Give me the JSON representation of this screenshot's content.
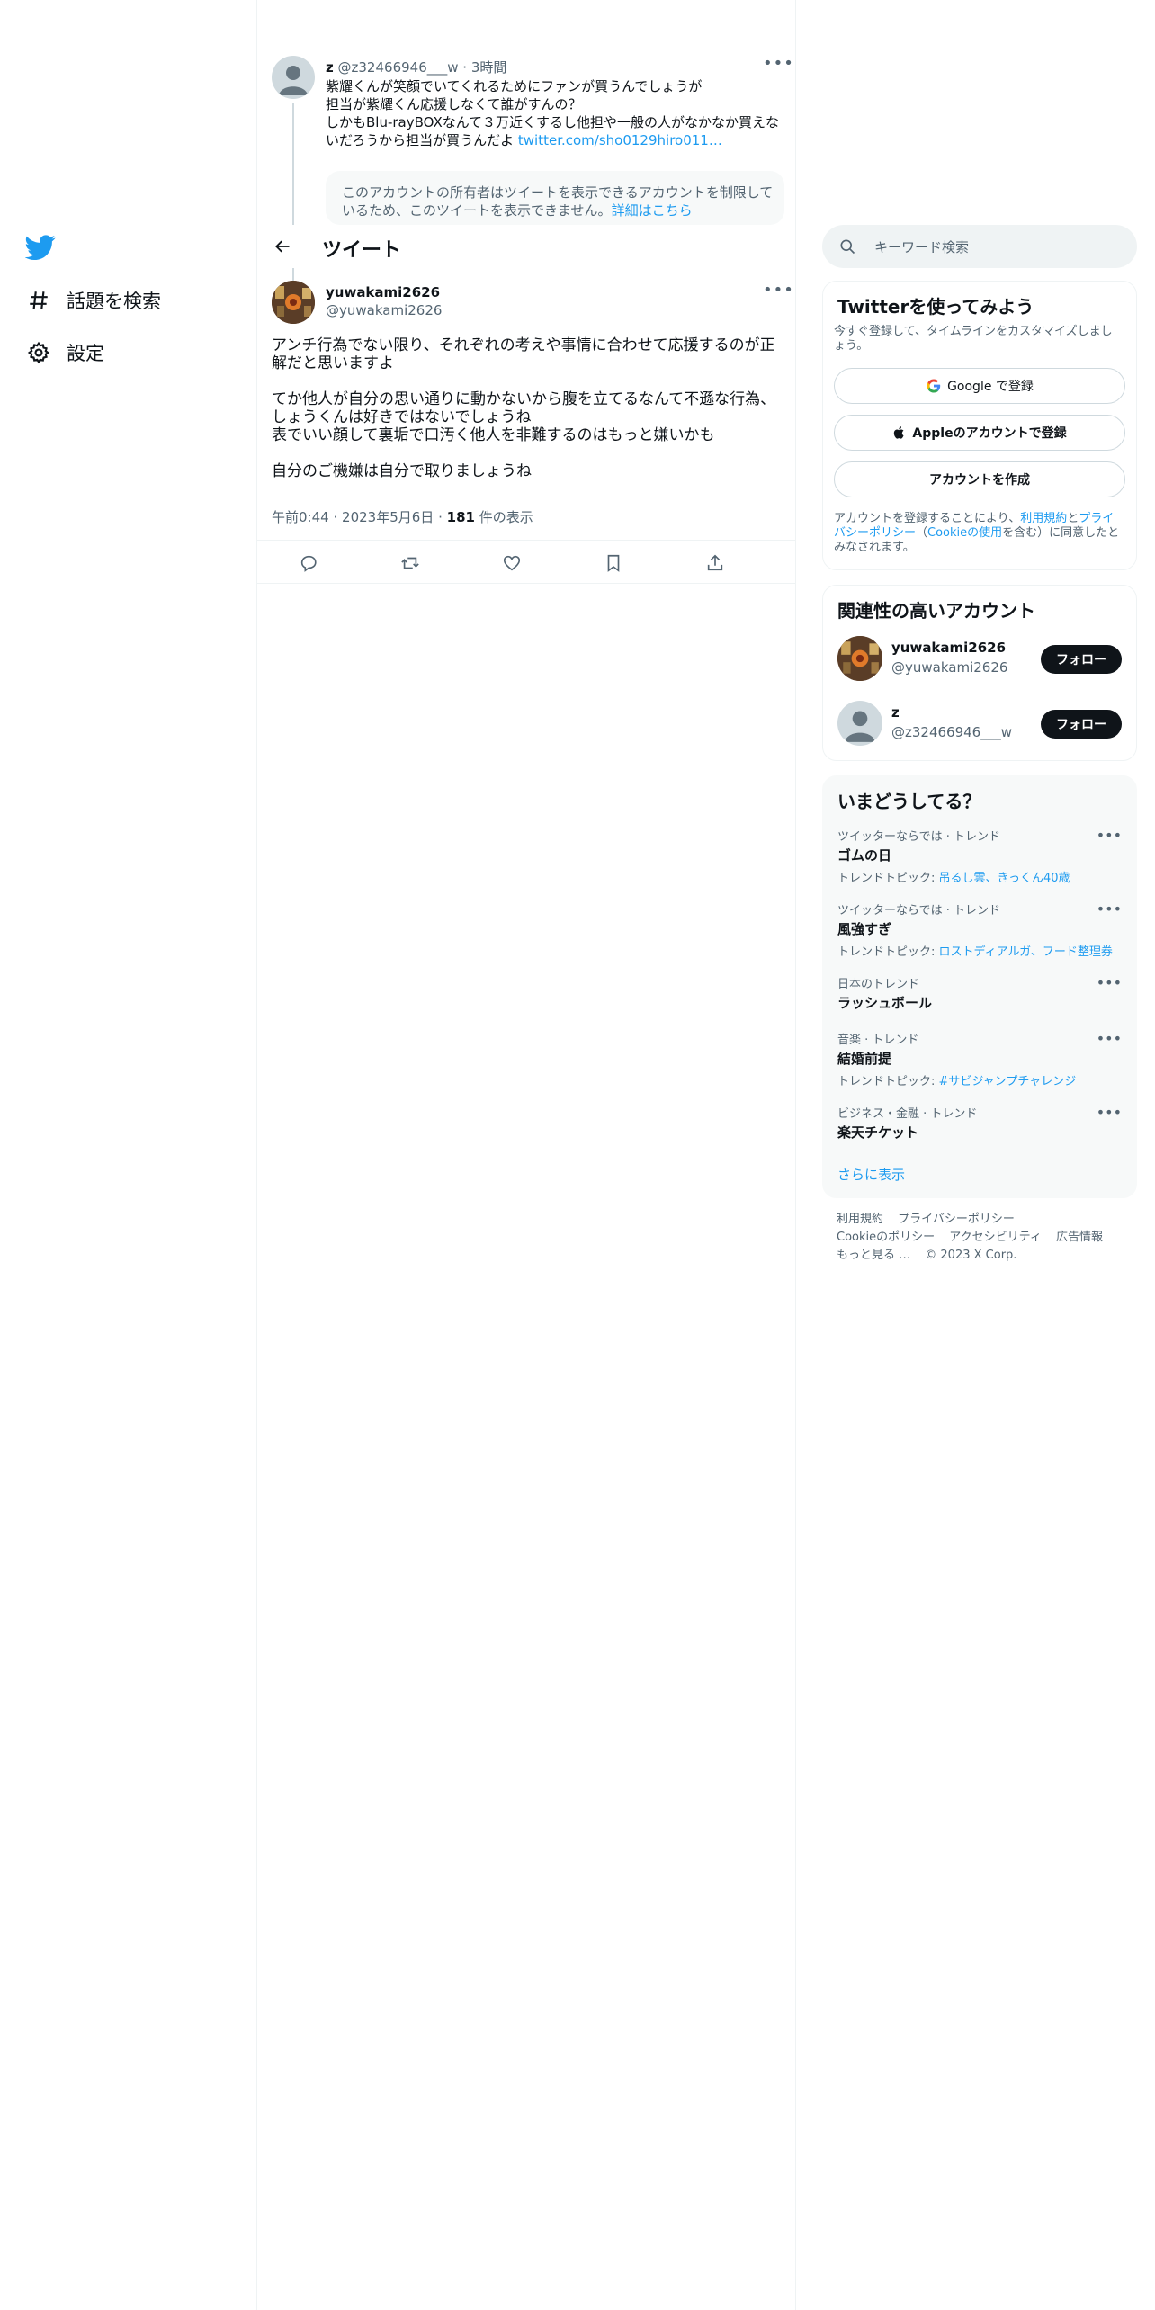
{
  "nav": {
    "explore_label": "話題を検索",
    "settings_label": "設定"
  },
  "header": {
    "title": "ツイート"
  },
  "parent_tweet": {
    "name": "z",
    "handle": "@z32466946___w",
    "separator": "·",
    "time": "3時間",
    "lines": [
      "紫耀くんが笑顔でいてくれるためにファンが買うんでしょうが",
      "担当が紫耀くん応援しなくて誰がすんの？",
      "しかもBlu-rayBOXなんて３万近くするし他担や一般の人がなかなか買えな",
      "いだろうから担当が買うんだよ"
    ],
    "link": "twitter.com/sho0129hiro011…",
    "restricted_text": "このアカウントの所有者はツイートを表示できるアカウントを制限しているため、このツイートを表示できません。",
    "restricted_link": "詳細はこちら"
  },
  "focal_tweet": {
    "name": "yuwakami2626",
    "handle": "@yuwakami2626",
    "paragraphs": [
      [
        "アンチ行為でない限り、それぞれの考えや事情に合わせて応援するのが正",
        "解だと思いますよ"
      ],
      [
        "てか他人が自分の思い通りに動かないから腹を立てるなんて不遜な行為、",
        "しょうくんは好きではないでしょうね",
        "表でいい顔して裏垢で口汚く他人を非難するのはもっと嫌いかも"
      ],
      [
        "自分のご機嫌は自分で取りましょうね"
      ]
    ],
    "time": "午前0:44",
    "date": "2023年5月6日",
    "dot": "·",
    "views_count": "181",
    "views_label": "件の表示"
  },
  "search": {
    "placeholder": "キーワード検索"
  },
  "signup": {
    "title": "Twitterを使ってみよう",
    "subtitle": "今すぐ登録して、タイムラインをカスタマイズしましょう。",
    "google_label": "Google で登録",
    "apple_label": "Appleのアカウントで登録",
    "create_label": "アカウントを作成",
    "legal_prefix": "アカウントを登録することにより、",
    "terms_link": "利用規約",
    "and": "と",
    "privacy_link": "プライバシーポリシー",
    "paren_open": "（",
    "cookie_link": "Cookieの使用",
    "legal_suffix": "を含む）に同意したとみなされます。"
  },
  "related": {
    "title": "関連性の高いアカウント",
    "accounts": [
      {
        "name": "yuwakami2626",
        "handle": "@yuwakami2626",
        "follow_label": "フォロー"
      },
      {
        "name": "z",
        "handle": "@z32466946___w",
        "follow_label": "フォロー"
      }
    ]
  },
  "trends": {
    "title": "いまどうしてる？",
    "items": [
      {
        "context": "ツイッターならでは · トレンド",
        "name": "ゴムの日",
        "topic_label": "トレンドトピック: ",
        "topic_links": "吊るし雲、きっくん40歳"
      },
      {
        "context": "ツイッターならでは · トレンド",
        "name": "風強すぎ",
        "topic_label": "トレンドトピック: ",
        "topic_links": "ロストディアルガ、フード整理券"
      },
      {
        "context": "日本のトレンド",
        "name": "ラッシュボール",
        "topic_label": "",
        "topic_links": ""
      },
      {
        "context": "音楽 · トレンド",
        "name": "結婚前提",
        "topic_label": "トレンドトピック: ",
        "topic_links": "#サビジャンプチャレンジ"
      },
      {
        "context": "ビジネス・金融 · トレンド",
        "name": "楽天チケット",
        "topic_label": "",
        "topic_links": ""
      }
    ],
    "show_more": "さらに表示"
  },
  "footer": {
    "links": [
      "利用規約",
      "プライバシーポリシー",
      "Cookieのポリシー",
      "アクセシビリティ",
      "広告情報",
      "もっと見る …",
      "© 2023 X Corp."
    ]
  },
  "colors": {
    "accent": "#1d9bf0",
    "text": "#0f1419",
    "muted": "#536471",
    "border": "#eff3f4",
    "button_dark": "#0f1419"
  }
}
